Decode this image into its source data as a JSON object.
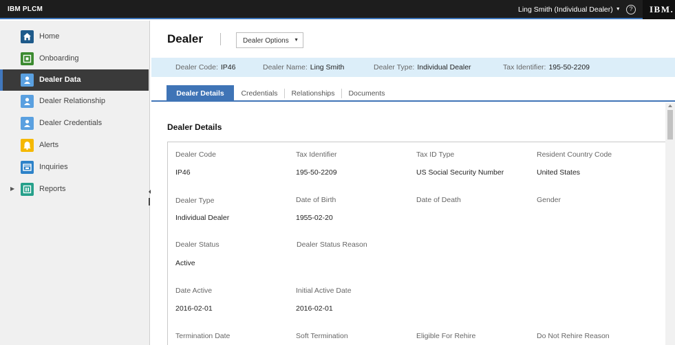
{
  "app": {
    "brand": "IBM PLCM",
    "user": "Ling Smith (Individual Dealer)",
    "help_icon": "?",
    "ibm_logo": "IBM."
  },
  "sidebar": {
    "items": [
      {
        "label": "Home",
        "icon": "home-icon",
        "color": "#1e5a8a"
      },
      {
        "label": "Onboarding",
        "icon": "onboarding-icon",
        "color": "#3b8a2f"
      },
      {
        "label": "Dealer Data",
        "icon": "dealer-icon",
        "color": "#5aa0e0",
        "active": true
      },
      {
        "label": "Dealer Relationship",
        "icon": "relationship-icon",
        "color": "#5aa0e0"
      },
      {
        "label": "Dealer Credentials",
        "icon": "credentials-icon",
        "color": "#5aa0e0"
      },
      {
        "label": "Alerts",
        "icon": "bell-icon",
        "color": "#f5b800"
      },
      {
        "label": "Inquiries",
        "icon": "inquiries-icon",
        "color": "#2d82c9"
      },
      {
        "label": "Reports",
        "icon": "reports-icon",
        "color": "#25a08a"
      }
    ]
  },
  "header": {
    "title": "Dealer",
    "options_label": "Dealer Options"
  },
  "infobar": {
    "dealer_code": {
      "label": "Dealer Code:",
      "value": "IP46"
    },
    "dealer_name": {
      "label": "Dealer Name:",
      "value": "Ling Smith"
    },
    "dealer_type": {
      "label": "Dealer Type:",
      "value": "Individual Dealer"
    },
    "tax_identifier": {
      "label": "Tax Identifier:",
      "value": "195-50-2209"
    }
  },
  "tabs": [
    "Dealer Details",
    "Credentials",
    "Relationships",
    "Documents"
  ],
  "section_title": "Dealer Details",
  "fields": {
    "dealer_code": {
      "label": "Dealer Code",
      "value": "IP46"
    },
    "tax_identifier": {
      "label": "Tax Identifier",
      "value": "195-50-2209"
    },
    "tax_id_type": {
      "label": "Tax ID Type",
      "value": "US Social Security Number"
    },
    "resident_country_code": {
      "label": "Resident Country Code",
      "value": "United States"
    },
    "dealer_type": {
      "label": "Dealer Type",
      "value": "Individual Dealer"
    },
    "date_of_birth": {
      "label": "Date of Birth",
      "value": "1955-02-20"
    },
    "date_of_death": {
      "label": "Date of Death",
      "value": ""
    },
    "gender": {
      "label": "Gender",
      "value": ""
    },
    "dealer_status": {
      "label": "Dealer Status",
      "value": "Active"
    },
    "dealer_status_reason": {
      "label": "Dealer Status Reason",
      "value": ""
    },
    "date_active": {
      "label": "Date Active",
      "value": "2016-02-01"
    },
    "initial_active_date": {
      "label": "Initial Active Date",
      "value": "2016-02-01"
    },
    "termination_date": {
      "label": "Termination Date",
      "value": ""
    },
    "soft_termination": {
      "label": "Soft Termination",
      "value": ""
    },
    "eligible_for_rehire": {
      "label": "Eligible For Rehire",
      "value": ""
    },
    "do_not_rehire_reason": {
      "label": "Do Not Rehire Reason",
      "value": ""
    }
  },
  "colors": {
    "accent": "#3f74b6",
    "topbar": "#1d1d1d",
    "infobar": "#dceef9",
    "sidebar_active": "#3a3a3a"
  }
}
